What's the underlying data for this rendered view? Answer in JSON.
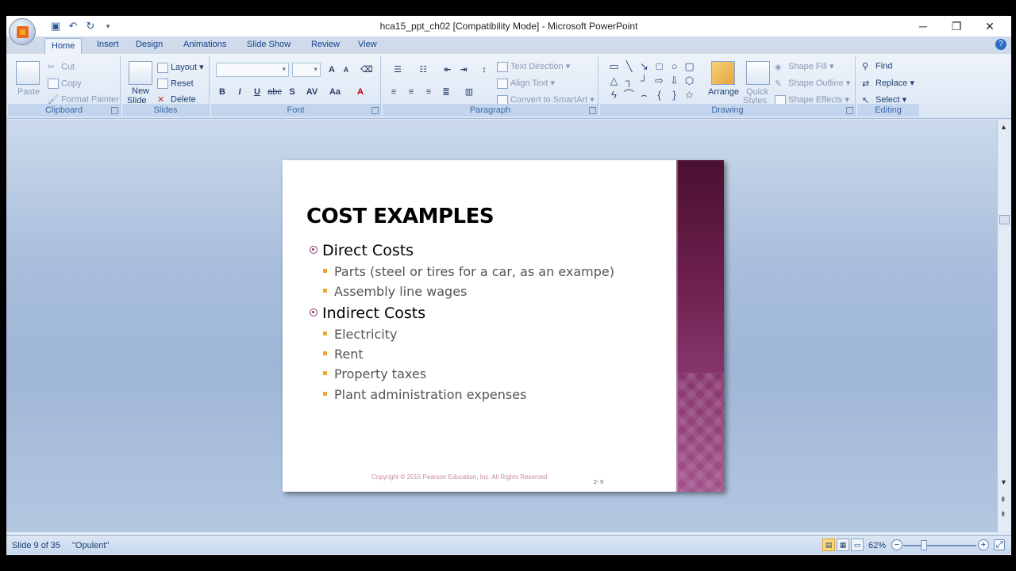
{
  "window": {
    "title": "hca15_ppt_ch02 [Compatibility Mode] - Microsoft PowerPoint",
    "minimize": "─",
    "restore": "❐",
    "close": "✕"
  },
  "tabs": [
    "Home",
    "Insert",
    "Design",
    "Animations",
    "Slide Show",
    "Review",
    "View"
  ],
  "ribbon": {
    "clipboard": {
      "paste": "Paste",
      "cut": "Cut",
      "copy": "Copy",
      "format_painter": "Format Painter",
      "label": "Clipboard"
    },
    "slides": {
      "new_slide": "New",
      "new_slide2": "Slide",
      "layout": "Layout",
      "reset": "Reset",
      "delete": "Delete",
      "label": "Slides"
    },
    "font": {
      "label": "Font",
      "bold": "B",
      "italic": "I",
      "underline": "U",
      "strike": "abc",
      "shadow": "S",
      "spacing": "AV",
      "case": "Aa",
      "color": "A",
      "grow": "A",
      "shrink": "A"
    },
    "paragraph": {
      "text_direction": "Text Direction",
      "align_text": "Align Text",
      "convert": "Convert to SmartArt",
      "label": "Paragraph"
    },
    "drawing": {
      "arrange": "Arrange",
      "quick": "Quick",
      "styles": "Styles",
      "shape_fill": "Shape Fill",
      "shape_outline": "Shape Outline",
      "shape_effects": "Shape Effects",
      "label": "Drawing"
    },
    "editing": {
      "find": "Find",
      "replace": "Replace",
      "select": "Select",
      "label": "Editing"
    }
  },
  "slide": {
    "title": "COST EXAMPLES",
    "sections": [
      {
        "heading": "Direct Costs",
        "items": [
          "Parts (steel or tires for a car,  as an exampe)",
          "Assembly line wages"
        ]
      },
      {
        "heading": "Indirect Costs",
        "items": [
          "Electricity",
          "Rent",
          "Property taxes",
          "Plant administration  expenses"
        ]
      }
    ],
    "copyright": "Copyright © 2015 Pearson Education, Inc. All Rights Reserved",
    "page": "2-     9"
  },
  "status": {
    "slide_info": "Slide 9 of 35",
    "theme": "\"Opulent\"",
    "zoom": "62%"
  }
}
